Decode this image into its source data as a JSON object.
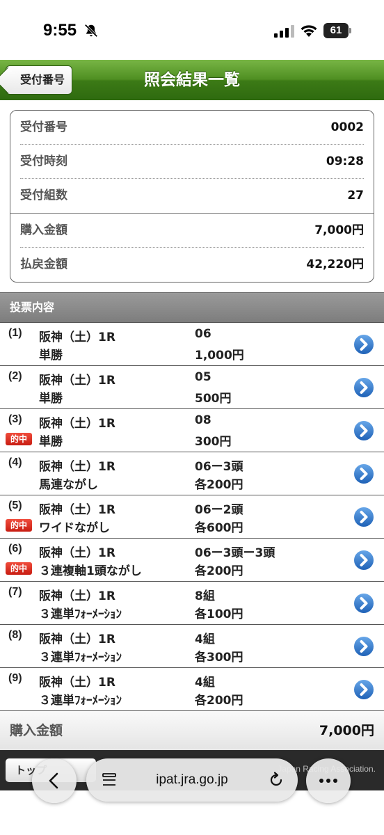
{
  "status_bar": {
    "time": "9:55",
    "battery": "61"
  },
  "header": {
    "back_label": "受付番号",
    "title": "照会結果一覧"
  },
  "summary": {
    "rows": [
      {
        "label": "受付番号",
        "value": "0002"
      },
      {
        "label": "受付時刻",
        "value": "09:28"
      },
      {
        "label": "受付組数",
        "value": "27"
      },
      {
        "label": "購入金額",
        "value": "7,000円"
      },
      {
        "label": "払戻金額",
        "value": "42,220円"
      }
    ]
  },
  "section": {
    "title": "投票内容"
  },
  "hit_label": "的中",
  "bets": [
    {
      "no": "(1)",
      "race": "阪神（土）1R",
      "type": "単勝",
      "combo": "06",
      "amount": "1,000円",
      "hit": false
    },
    {
      "no": "(2)",
      "race": "阪神（土）1R",
      "type": "単勝",
      "combo": "05",
      "amount": "500円",
      "hit": false
    },
    {
      "no": "(3)",
      "race": "阪神（土）1R",
      "type": "単勝",
      "combo": "08",
      "amount": "300円",
      "hit": true
    },
    {
      "no": "(4)",
      "race": "阪神（土）1R",
      "type": "馬連ながし",
      "combo": "06ー3頭",
      "amount": "各200円",
      "hit": false
    },
    {
      "no": "(5)",
      "race": "阪神（土）1R",
      "type": "ワイドながし",
      "combo": "06ー2頭",
      "amount": "各600円",
      "hit": true
    },
    {
      "no": "(6)",
      "race": "阪神（土）1R",
      "type": "３連複軸1頭ながし",
      "combo": "06ー3頭ー3頭",
      "amount": "各200円",
      "hit": true
    },
    {
      "no": "(7)",
      "race": "阪神（土）1R",
      "type": "３連単ﾌｫｰﾒｰｼｮﾝ",
      "combo": "8組",
      "amount": "各100円",
      "hit": false
    },
    {
      "no": "(8)",
      "race": "阪神（土）1R",
      "type": "３連単ﾌｫｰﾒｰｼｮﾝ",
      "combo": "4組",
      "amount": "各300円",
      "hit": false
    },
    {
      "no": "(9)",
      "race": "阪神（土）1R",
      "type": "３連単ﾌｫｰﾒｰｼｮﾝ",
      "combo": "4組",
      "amount": "各200円",
      "hit": false
    }
  ],
  "total": {
    "label": "購入金額",
    "value": "7,000円"
  },
  "footer": {
    "top_button_label": "トップ",
    "credit": "Japan Racing Association."
  },
  "browser": {
    "url": "ipat.jra.go.jp"
  }
}
